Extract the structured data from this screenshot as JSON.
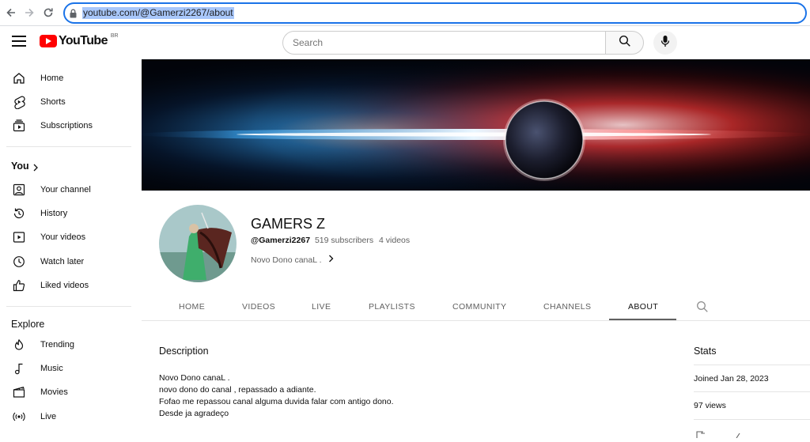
{
  "browser": {
    "url": "youtube.com/@Gamerzi2267/about"
  },
  "masthead": {
    "logo_text": "YouTube",
    "region": "BR",
    "search_placeholder": "Search"
  },
  "sidebar": {
    "main": [
      {
        "label": "Home",
        "icon": "home-icon"
      },
      {
        "label": "Shorts",
        "icon": "shorts-icon"
      },
      {
        "label": "Subscriptions",
        "icon": "subscriptions-icon"
      }
    ],
    "you_heading": "You",
    "you_items": [
      {
        "label": "Your channel",
        "icon": "your-channel-icon"
      },
      {
        "label": "History",
        "icon": "history-icon"
      },
      {
        "label": "Your videos",
        "icon": "your-videos-icon"
      },
      {
        "label": "Watch later",
        "icon": "watch-later-icon"
      },
      {
        "label": "Liked videos",
        "icon": "liked-videos-icon"
      }
    ],
    "explore_heading": "Explore",
    "explore_items": [
      {
        "label": "Trending",
        "icon": "trending-icon"
      },
      {
        "label": "Music",
        "icon": "music-icon"
      },
      {
        "label": "Movies",
        "icon": "movies-icon"
      },
      {
        "label": "Live",
        "icon": "live-icon"
      }
    ]
  },
  "channel": {
    "name": "GAMERS Z",
    "handle": "@Gamerzi2267",
    "subscribers": "519 subscribers",
    "videos": "4 videos",
    "short_description": "Novo Dono canaL ."
  },
  "tabs": [
    "HOME",
    "VIDEOS",
    "LIVE",
    "PLAYLISTS",
    "COMMUNITY",
    "CHANNELS",
    "ABOUT"
  ],
  "active_tab": "ABOUT",
  "about": {
    "description_title": "Description",
    "description_lines": [
      "Novo Dono canaL .",
      "novo dono do canal , repassado a adiante.",
      "Fofao me repassou canal alguma duvida falar com antigo dono.",
      "Desde ja agradeço"
    ],
    "stats_title": "Stats",
    "joined": "Joined Jan 28, 2023",
    "views": "97 views"
  },
  "colors": {
    "accent_red": "#ff0000",
    "url_highlight": "#a8c7fa",
    "focus_ring": "#1a73e8"
  }
}
